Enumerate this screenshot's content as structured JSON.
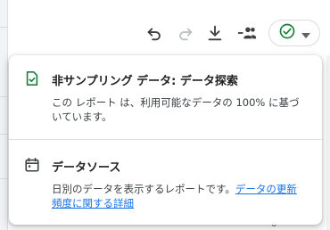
{
  "toolbar": {
    "icons": [
      "undo-icon",
      "redo-icon",
      "download-icon",
      "share-people-icon",
      "check-circle-icon",
      "dropdown-arrow-icon"
    ]
  },
  "popup": {
    "sampling": {
      "icon": "check-doc-icon",
      "title": "非サンプリング データ: データ探索",
      "description": "この レポート は、利用可能なデータの 100% に基づいています。"
    },
    "data_source": {
      "icon": "calendar-icon",
      "title": "データソース",
      "description": "日別のデータを表示するレポートです。",
      "link_text": "データの更新頻度に関する詳細"
    }
  },
  "background": {
    "bottom_mark": "0"
  },
  "colors": {
    "accent_green": "#188038",
    "link_blue": "#1a73e8",
    "icon_gray": "#3c4043"
  }
}
